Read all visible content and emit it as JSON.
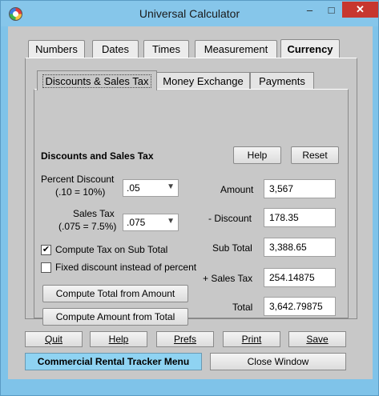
{
  "window": {
    "title": "Universal Calculator",
    "minimize": "–",
    "maximize": "□",
    "close": "✕"
  },
  "main_tabs": [
    "Numbers",
    "Dates",
    "Times",
    "Measurement",
    "Currency"
  ],
  "main_tab_active": "Currency",
  "sub_tabs": [
    "Discounts & Sales Tax",
    "Money Exchange",
    "Payments"
  ],
  "sub_tab_active": "Discounts & Sales Tax",
  "section": {
    "heading": "Discounts and Sales Tax",
    "help_label": "Help",
    "reset_label": "Reset"
  },
  "percent_discount": {
    "label_line1": "Percent Discount",
    "label_line2": "(.10 = 10%)",
    "value": ".05"
  },
  "sales_tax": {
    "label_line1": "Sales Tax",
    "label_line2": "(.075 = 7.5%)",
    "value": ".075"
  },
  "options": {
    "compute_tax_label": "Compute Tax on Sub Total",
    "compute_tax_checked": true,
    "fixed_discount_label": "Fixed discount instead of percent",
    "fixed_discount_checked": false
  },
  "actions": {
    "total_from_amount": "Compute Total from Amount",
    "amount_from_total": "Compute Amount from Total"
  },
  "results": {
    "amount_label": "Amount",
    "amount": "3,567",
    "discount_label": "- Discount",
    "discount": "178.35",
    "subtotal_label": "Sub Total",
    "subtotal": "3,388.65",
    "salestax_label": "+ Sales Tax",
    "salestax": "254.14875",
    "total_label": "Total",
    "total": "3,642.79875"
  },
  "bottom": {
    "quit": "Quit",
    "help": "Help",
    "prefs": "Prefs",
    "print": "Print",
    "save": "Save",
    "rental_tracker": "Commercial Rental Tracker Menu",
    "close_window": "Close Window"
  },
  "colors": {
    "titlebar": "#86c6ea",
    "close_button": "#c7372f",
    "rental_button": "#8fd3f2"
  }
}
